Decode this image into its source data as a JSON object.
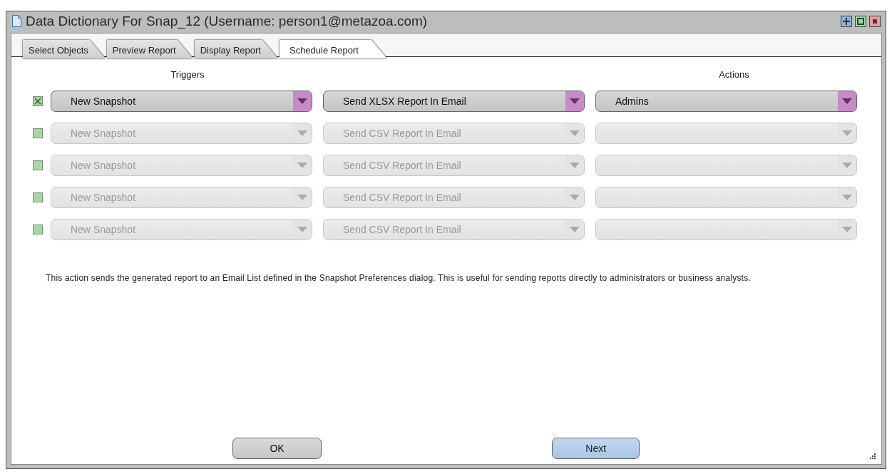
{
  "window": {
    "title": "Data Dictionary For Snap_12 (Username: person1@metazoa.com)"
  },
  "tabs": [
    {
      "label": "Select Objects",
      "selected": false
    },
    {
      "label": "Preview Report",
      "selected": false
    },
    {
      "label": "Display Report",
      "selected": false
    },
    {
      "label": "Schedule Report",
      "selected": true
    }
  ],
  "headings": {
    "triggers": "Triggers",
    "actions": "Actions"
  },
  "rows": [
    {
      "checked": true,
      "enabled": true,
      "trigger": "New Snapshot",
      "action": "Send XLSX Report In Email",
      "target": "Admins"
    },
    {
      "checked": false,
      "enabled": false,
      "trigger": "New Snapshot",
      "action": "Send CSV Report In Email",
      "target": ""
    },
    {
      "checked": false,
      "enabled": false,
      "trigger": "New Snapshot",
      "action": "Send CSV Report In Email",
      "target": ""
    },
    {
      "checked": false,
      "enabled": false,
      "trigger": "New Snapshot",
      "action": "Send CSV Report In Email",
      "target": ""
    },
    {
      "checked": false,
      "enabled": false,
      "trigger": "New Snapshot",
      "action": "Send CSV Report In Email",
      "target": ""
    }
  ],
  "description": "This action sends the generated report to an Email List defined in the Snapshot Preferences dialog. This is useful for sending reports directly to administrators or business analysts.",
  "buttons": [
    {
      "label": "OK",
      "kind": "plain"
    },
    {
      "label": "Next",
      "kind": "default"
    }
  ]
}
